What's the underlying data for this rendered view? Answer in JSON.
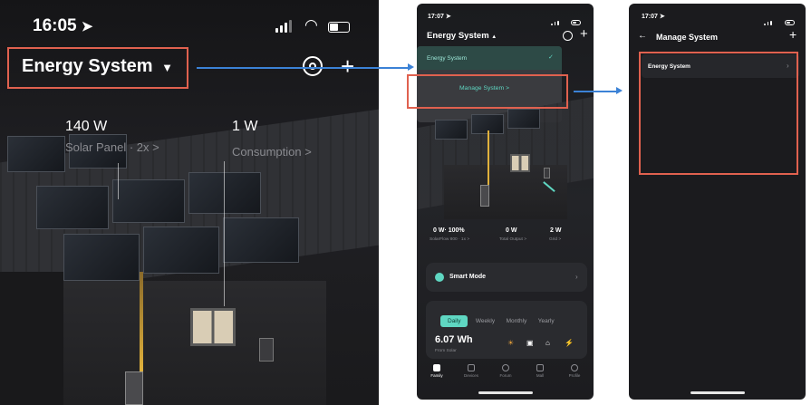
{
  "phone1": {
    "time": "16:05",
    "title": "Energy System",
    "solar_value": "140 W",
    "solar_label": "Solar Panel · 2x >",
    "consumption_value": "1 W",
    "consumption_label": "Consumption >"
  },
  "phone2": {
    "time": "17:07",
    "title": "Energy System",
    "dropdown_item": "Energy System",
    "manage_label": "Manage System >",
    "stats": [
      {
        "value": "0 W· 100%",
        "label": "SolarFlow 800 · 1x >"
      },
      {
        "value": "0 W",
        "label": "Total Output >"
      },
      {
        "value": "2 W",
        "label": "Grid >"
      }
    ],
    "smart_mode": "Smart Mode",
    "tabs": [
      "Daily",
      "Weekly",
      "Monthly",
      "Yearly"
    ],
    "energy_value": "6.07 Wh",
    "energy_label": "From Solar",
    "nav": [
      "Family",
      "Devices",
      "Forum",
      "Mall",
      "Profile"
    ]
  },
  "phone3": {
    "time": "17:07",
    "title": "Manage System",
    "item": "Energy System"
  },
  "colors": {
    "accent": "#5fd7c2",
    "annotation_box": "#e0614f",
    "annotation_arrow": "#3b82d6"
  }
}
